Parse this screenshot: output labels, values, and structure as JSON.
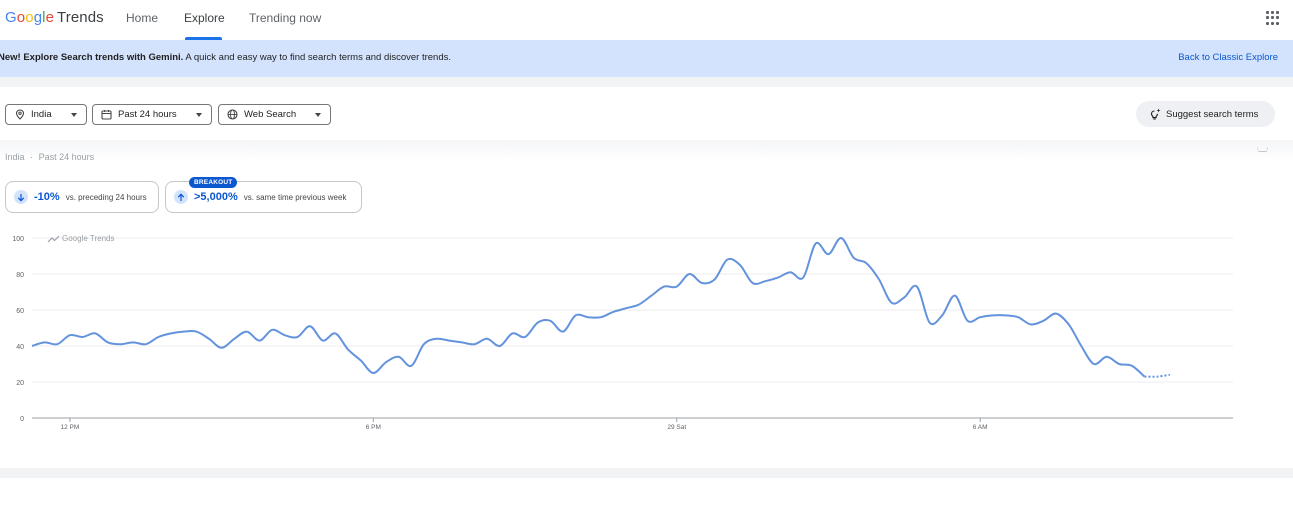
{
  "header": {
    "logo_google": "Google",
    "logo_trends": "Trends",
    "nav": [
      {
        "label": "Home"
      },
      {
        "label": "Explore"
      },
      {
        "label": "Trending now"
      }
    ],
    "apps_icon": "apps-grid-icon"
  },
  "banner": {
    "bold": "New! Explore Search trends with Gemini.",
    "text": " A quick and easy way to find search terms and discover trends.",
    "link": "Back to Classic Explore"
  },
  "filters": {
    "location": "India",
    "time": "Past 24 hours",
    "property": "Web Search",
    "suggest": "Suggest search terms"
  },
  "context": {
    "location": "India",
    "separator": "·",
    "time": "Past 24 hours"
  },
  "stats": [
    {
      "value": "-10%",
      "desc": "vs. preceding 24 hours",
      "direction": "down"
    },
    {
      "badge": "BREAKOUT",
      "value": ">5,000%",
      "desc": "vs. same time previous week",
      "direction": "up"
    }
  ],
  "colors": {
    "line": "#6493de",
    "accent": "#0b57d0",
    "banner": "#d3e3fd"
  },
  "chart_data": {
    "type": "line",
    "watermark": "Google Trends",
    "ylim": [
      0,
      100
    ],
    "yticks": [
      0,
      20,
      40,
      60,
      80,
      100
    ],
    "grid": true,
    "x_ticks": [
      {
        "label": "12 PM",
        "x": 1.25
      },
      {
        "label": "6 PM",
        "x": 7.25
      },
      {
        "label": "29 Sat",
        "x": 13.25
      },
      {
        "label": "6 AM",
        "x": 19.25
      }
    ],
    "xlim": [
      0.5,
      24.25
    ],
    "series": [
      {
        "values": [
          [
            0.5,
            40
          ],
          [
            0.75,
            42
          ],
          [
            1.0,
            41
          ],
          [
            1.25,
            46
          ],
          [
            1.5,
            45
          ],
          [
            1.75,
            47
          ],
          [
            2.0,
            42
          ],
          [
            2.25,
            41
          ],
          [
            2.5,
            42
          ],
          [
            2.75,
            41
          ],
          [
            3.0,
            45
          ],
          [
            3.25,
            47
          ],
          [
            3.5,
            48
          ],
          [
            3.75,
            48
          ],
          [
            4.0,
            44
          ],
          [
            4.25,
            39
          ],
          [
            4.5,
            44
          ],
          [
            4.75,
            48
          ],
          [
            5.0,
            43
          ],
          [
            5.25,
            49
          ],
          [
            5.5,
            46
          ],
          [
            5.75,
            45
          ],
          [
            6.0,
            51
          ],
          [
            6.25,
            43
          ],
          [
            6.5,
            47
          ],
          [
            6.75,
            38
          ],
          [
            7.0,
            32
          ],
          [
            7.25,
            25
          ],
          [
            7.5,
            31
          ],
          [
            7.75,
            34
          ],
          [
            8.0,
            29
          ],
          [
            8.25,
            41
          ],
          [
            8.5,
            44
          ],
          [
            8.75,
            43
          ],
          [
            9.0,
            42
          ],
          [
            9.25,
            41
          ],
          [
            9.5,
            44
          ],
          [
            9.75,
            40
          ],
          [
            10.0,
            47
          ],
          [
            10.25,
            45
          ],
          [
            10.5,
            53
          ],
          [
            10.75,
            54
          ],
          [
            11.0,
            48
          ],
          [
            11.25,
            57
          ],
          [
            11.5,
            56
          ],
          [
            11.75,
            56
          ],
          [
            12.0,
            59
          ],
          [
            12.25,
            61
          ],
          [
            12.5,
            63
          ],
          [
            12.75,
            68
          ],
          [
            13.0,
            73
          ],
          [
            13.25,
            73
          ],
          [
            13.5,
            80
          ],
          [
            13.75,
            75
          ],
          [
            14.0,
            77
          ],
          [
            14.25,
            88
          ],
          [
            14.5,
            85
          ],
          [
            14.75,
            75
          ],
          [
            15.0,
            76
          ],
          [
            15.25,
            78
          ],
          [
            15.5,
            81
          ],
          [
            15.75,
            78
          ],
          [
            16.0,
            97
          ],
          [
            16.25,
            91
          ],
          [
            16.5,
            100
          ],
          [
            16.75,
            89
          ],
          [
            17.0,
            86
          ],
          [
            17.25,
            77
          ],
          [
            17.5,
            64
          ],
          [
            17.75,
            67
          ],
          [
            18.0,
            73
          ],
          [
            18.25,
            53
          ],
          [
            18.5,
            57
          ],
          [
            18.75,
            68
          ],
          [
            19.0,
            54
          ],
          [
            19.25,
            56
          ],
          [
            19.5,
            57
          ],
          [
            19.75,
            57
          ],
          [
            20.0,
            56
          ],
          [
            20.25,
            52
          ],
          [
            20.5,
            54
          ],
          [
            20.75,
            58
          ],
          [
            21.0,
            52
          ],
          [
            21.25,
            40
          ],
          [
            21.5,
            30
          ],
          [
            21.75,
            34
          ],
          [
            22.0,
            30
          ],
          [
            22.25,
            29
          ],
          [
            22.5,
            23
          ]
        ],
        "partial": [
          [
            22.5,
            23
          ],
          [
            22.75,
            23
          ],
          [
            23.0,
            24
          ]
        ]
      }
    ]
  }
}
